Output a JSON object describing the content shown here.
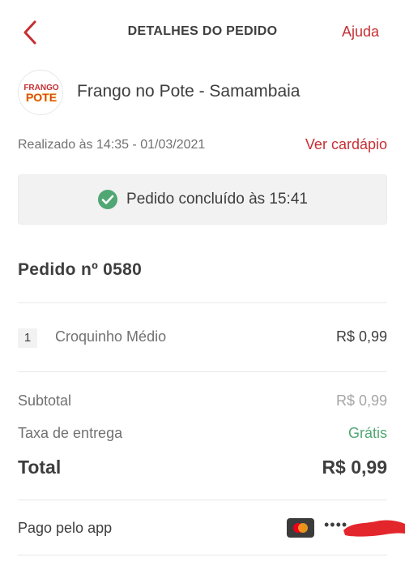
{
  "header": {
    "title": "DETALHES DO PEDIDO",
    "help_label": "Ajuda"
  },
  "store": {
    "name": "Frango no Pote - Samambaia",
    "logo_text_top": "FRANGO",
    "logo_text_bottom": "POTE"
  },
  "order": {
    "placed_at": "Realizado às 14:35 - 01/03/2021",
    "menu_link": "Ver cardápio",
    "status": "Pedido concluído às 15:41",
    "number_label": "Pedido nº 0580",
    "items": [
      {
        "qty": "1",
        "name": "Croquinho Médio",
        "price": "R$ 0,99"
      }
    ]
  },
  "summary": {
    "subtotal_label": "Subtotal",
    "subtotal_value": "R$ 0,99",
    "delivery_label": "Taxa de entrega",
    "delivery_value": "Grátis",
    "total_label": "Total",
    "total_value": "R$ 0,99"
  },
  "payment": {
    "label": "Pago pelo app",
    "card_masked": "••••",
    "card_brand": "mastercard-icon"
  },
  "colors": {
    "accent": "#c62f33",
    "success": "#50a773"
  }
}
